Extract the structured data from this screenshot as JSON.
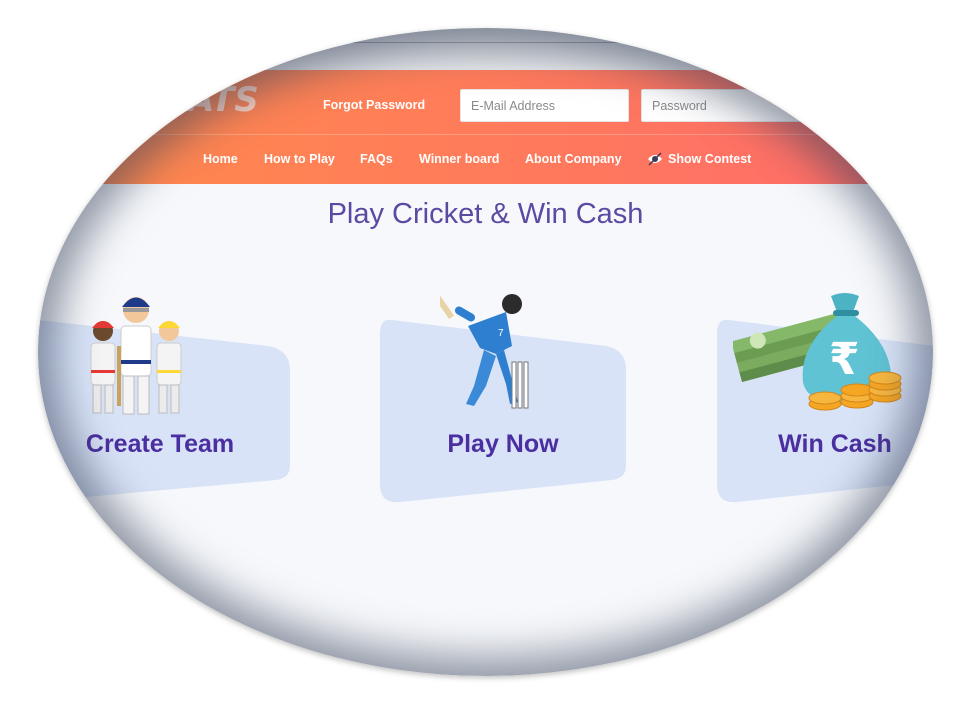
{
  "header": {
    "logo": "ATS",
    "forgot_password": "Forgot Password",
    "email_placeholder": "E-Mail Address",
    "password_placeholder": "Password"
  },
  "nav": {
    "items": [
      {
        "label": "Home"
      },
      {
        "label": "How to Play"
      },
      {
        "label": "FAQs"
      },
      {
        "label": "Winner board"
      },
      {
        "label": "About Company"
      },
      {
        "label": "Show Contest",
        "icon": "eye-icon"
      }
    ]
  },
  "main": {
    "title": "Play Cricket & Win Cash",
    "cards": [
      {
        "label": "Create Team",
        "icon": "cricket-players-icon"
      },
      {
        "label": "Play Now",
        "icon": "batsman-icon"
      },
      {
        "label": "Win Cash",
        "icon": "money-bag-icon"
      }
    ]
  },
  "colors": {
    "header_gradient_start": "#ff8a4c",
    "header_gradient_end": "#ff6b6b",
    "title": "#5b4aa3",
    "card_label": "#4b2ea0",
    "card_bg": "#d8e3f8"
  }
}
